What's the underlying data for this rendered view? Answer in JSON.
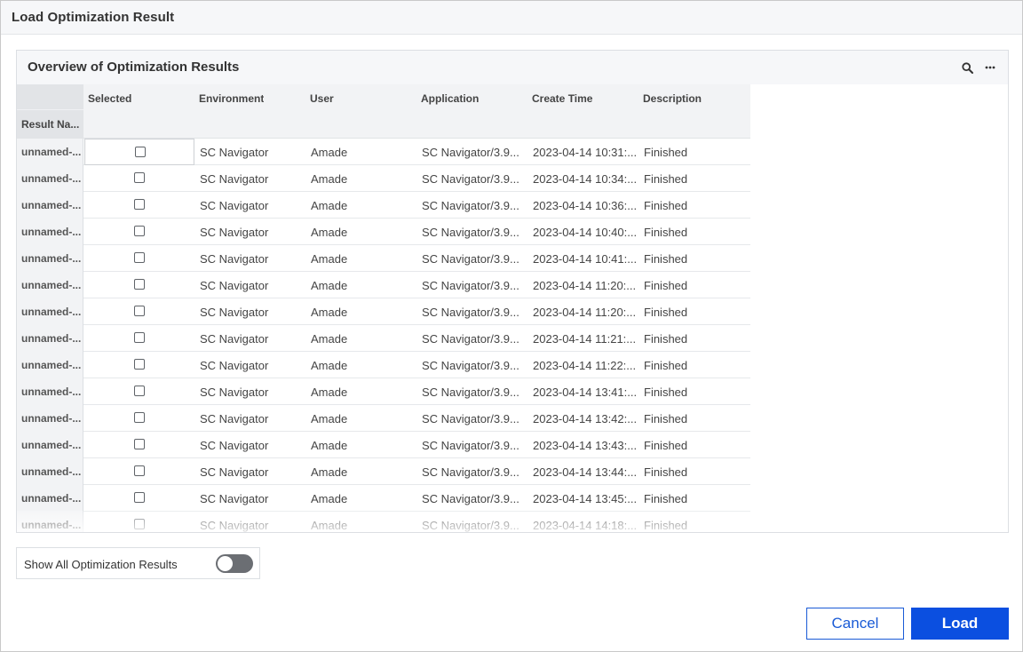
{
  "dialog": {
    "title": "Load Optimization Result"
  },
  "panel": {
    "title": "Overview of Optimization Results",
    "tools": [
      {
        "icon": "search-icon"
      },
      {
        "icon": "more-icon"
      }
    ]
  },
  "table": {
    "columns": {
      "name": "Result Na...",
      "selected": "Selected",
      "environment": "Environment",
      "user": "User",
      "application": "Application",
      "create_time": "Create Time",
      "description": "Description"
    },
    "rows": [
      {
        "name": "unnamed-...",
        "selected": false,
        "environment": "SC Navigator",
        "user": "Amade",
        "application": "SC Navigator/3.9...",
        "create_time": "2023-04-14 10:31:...",
        "description": "Finished"
      },
      {
        "name": "unnamed-...",
        "selected": false,
        "environment": "SC Navigator",
        "user": "Amade",
        "application": "SC Navigator/3.9...",
        "create_time": "2023-04-14 10:34:...",
        "description": "Finished"
      },
      {
        "name": "unnamed-...",
        "selected": false,
        "environment": "SC Navigator",
        "user": "Amade",
        "application": "SC Navigator/3.9...",
        "create_time": "2023-04-14 10:36:...",
        "description": "Finished"
      },
      {
        "name": "unnamed-...",
        "selected": false,
        "environment": "SC Navigator",
        "user": "Amade",
        "application": "SC Navigator/3.9...",
        "create_time": "2023-04-14 10:40:...",
        "description": "Finished"
      },
      {
        "name": "unnamed-...",
        "selected": false,
        "environment": "SC Navigator",
        "user": "Amade",
        "application": "SC Navigator/3.9...",
        "create_time": "2023-04-14 10:41:...",
        "description": "Finished"
      },
      {
        "name": "unnamed-...",
        "selected": false,
        "environment": "SC Navigator",
        "user": "Amade",
        "application": "SC Navigator/3.9...",
        "create_time": "2023-04-14 11:20:...",
        "description": "Finished"
      },
      {
        "name": "unnamed-...",
        "selected": false,
        "environment": "SC Navigator",
        "user": "Amade",
        "application": "SC Navigator/3.9...",
        "create_time": "2023-04-14 11:20:...",
        "description": "Finished"
      },
      {
        "name": "unnamed-...",
        "selected": false,
        "environment": "SC Navigator",
        "user": "Amade",
        "application": "SC Navigator/3.9...",
        "create_time": "2023-04-14 11:21:...",
        "description": "Finished"
      },
      {
        "name": "unnamed-...",
        "selected": false,
        "environment": "SC Navigator",
        "user": "Amade",
        "application": "SC Navigator/3.9...",
        "create_time": "2023-04-14 11:22:...",
        "description": "Finished"
      },
      {
        "name": "unnamed-...",
        "selected": false,
        "environment": "SC Navigator",
        "user": "Amade",
        "application": "SC Navigator/3.9...",
        "create_time": "2023-04-14 13:41:...",
        "description": "Finished"
      },
      {
        "name": "unnamed-...",
        "selected": false,
        "environment": "SC Navigator",
        "user": "Amade",
        "application": "SC Navigator/3.9...",
        "create_time": "2023-04-14 13:42:...",
        "description": "Finished"
      },
      {
        "name": "unnamed-...",
        "selected": false,
        "environment": "SC Navigator",
        "user": "Amade",
        "application": "SC Navigator/3.9...",
        "create_time": "2023-04-14 13:43:...",
        "description": "Finished"
      },
      {
        "name": "unnamed-...",
        "selected": false,
        "environment": "SC Navigator",
        "user": "Amade",
        "application": "SC Navigator/3.9...",
        "create_time": "2023-04-14 13:44:...",
        "description": "Finished"
      },
      {
        "name": "unnamed-...",
        "selected": false,
        "environment": "SC Navigator",
        "user": "Amade",
        "application": "SC Navigator/3.9...",
        "create_time": "2023-04-14 13:45:...",
        "description": "Finished"
      },
      {
        "name": "unnamed-...",
        "selected": false,
        "environment": "SC Navigator",
        "user": "Amade",
        "application": "SC Navigator/3.9...",
        "create_time": "2023-04-14 14:18:...",
        "description": "Finished"
      }
    ]
  },
  "toggle": {
    "label": "Show All Optimization Results",
    "on": false
  },
  "buttons": {
    "cancel": "Cancel",
    "load": "Load"
  },
  "colors": {
    "accent": "#0b4fe0",
    "toggle_off": "#6b6e73",
    "header_bg": "#f6f7f9"
  }
}
